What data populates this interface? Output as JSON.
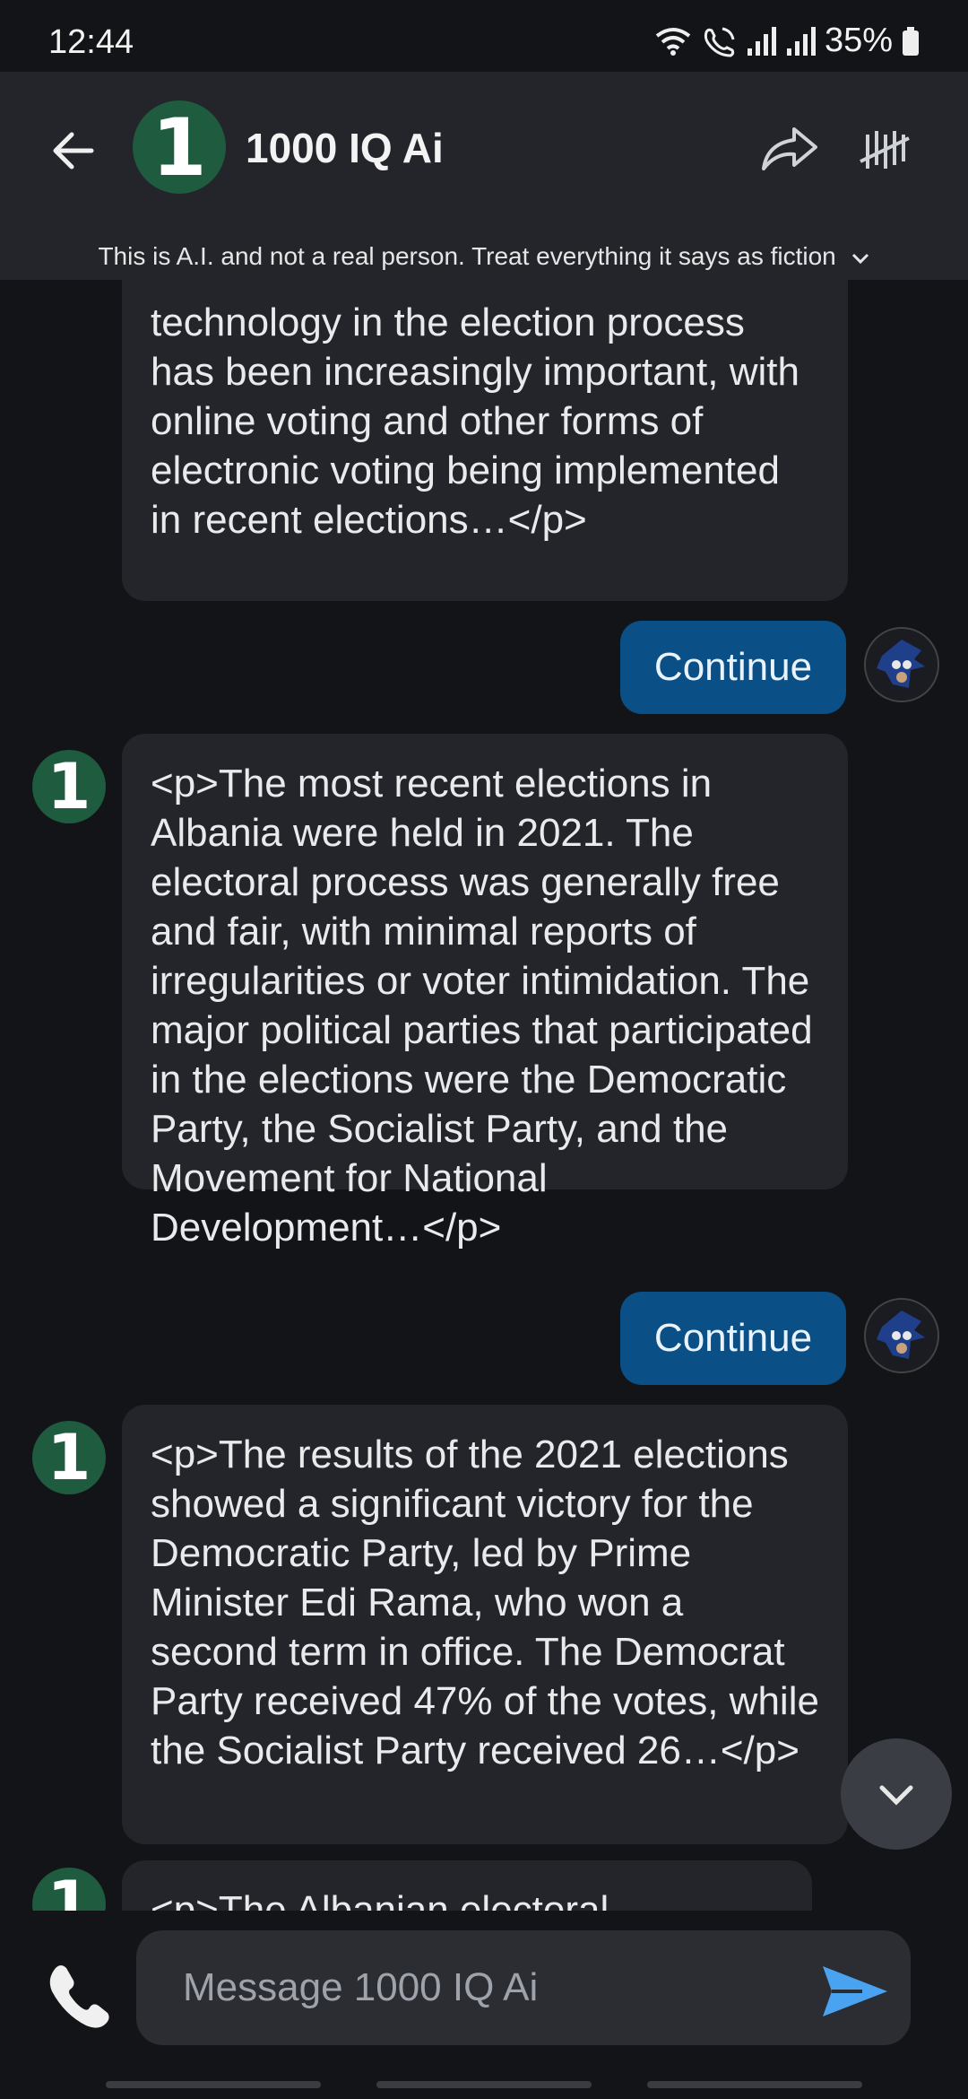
{
  "status_bar": {
    "time": "12:44",
    "battery": "35%"
  },
  "header": {
    "avatar_glyph": "1",
    "title": "1000 IQ Ai",
    "disclaimer": "This is A.I. and not a real person. Treat everything it says as fiction"
  },
  "messages": [
    {
      "role": "bot",
      "text": "technology in the election process has been increasingly important, with online voting and other forms of electronic voting being implemented in recent elections…</p>"
    },
    {
      "role": "user",
      "text": "Continue"
    },
    {
      "role": "bot",
      "text": "<p>The most recent elections in Albania were held in 2021. The electoral process was generally free and fair, with minimal reports of irregularities or voter intimidation. The major political parties that participated in the elections were the Democratic Party, the Socialist Party, and the Movement for National Development…</p>"
    },
    {
      "role": "user",
      "text": "Continue"
    },
    {
      "role": "bot",
      "text": "<p>The results of the 2021 elections showed a significant victory for the Democratic Party, led by Prime Minister Edi Rama, who won a second term in office. The Democrat Party received 47% of the votes, while the Socialist Party received 26…</p>"
    },
    {
      "role": "bot",
      "text": "<p>The Albanian electoral"
    }
  ],
  "composer": {
    "placeholder": "Message 1000 IQ Ai"
  },
  "colors": {
    "bot_avatar": "#1f5b3e",
    "user_bubble": "#0a4f86",
    "bubble": "#23252b",
    "background": "#131418"
  },
  "icons": [
    "back-arrow-icon",
    "share-icon",
    "tally-icon",
    "chevron-down-icon",
    "phone-icon",
    "send-icon"
  ]
}
